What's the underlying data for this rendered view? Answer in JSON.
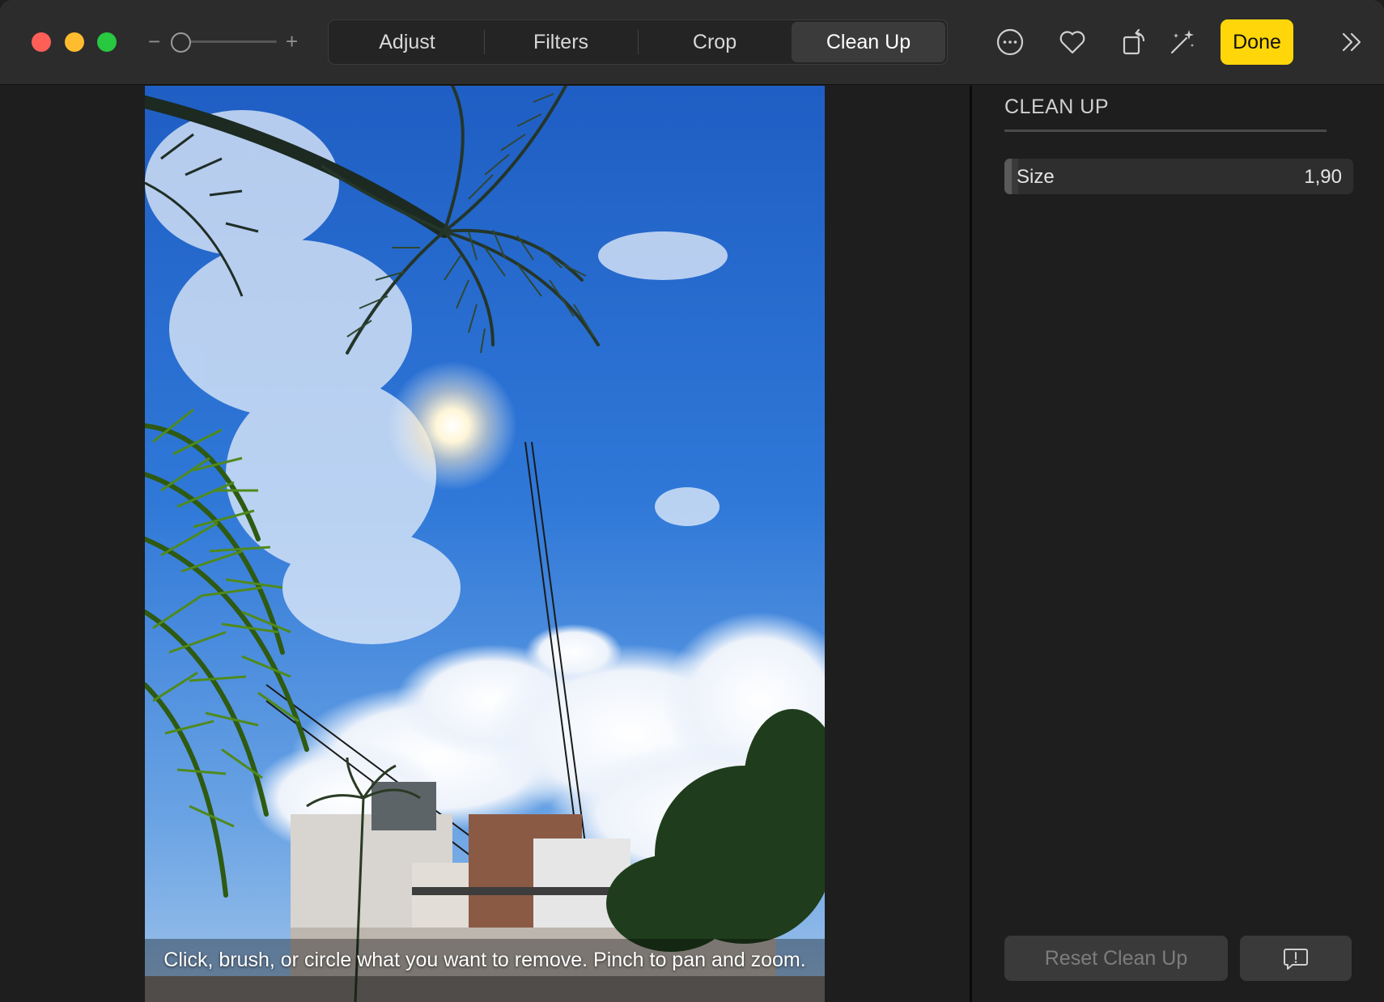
{
  "toolbar": {
    "zoom_minus": "−",
    "zoom_plus": "+",
    "tabs": [
      {
        "label": "Adjust"
      },
      {
        "label": "Filters"
      },
      {
        "label": "Crop"
      },
      {
        "label": "Clean Up"
      }
    ],
    "active_tab": "Clean Up",
    "icons": [
      "more-options-icon",
      "favorite-heart-icon",
      "rotate-icon",
      "auto-enhance-icon",
      "expand-chevrons-icon"
    ],
    "done_label": "Done",
    "done_color": "#ffd60a"
  },
  "canvas": {
    "hint": "Click, brush, or circle what you want to remove. Pinch to pan and zoom."
  },
  "panel": {
    "title": "CLEAN UP",
    "size_label": "Size",
    "size_value": "1,90",
    "reset_label": "Reset Clean Up"
  }
}
